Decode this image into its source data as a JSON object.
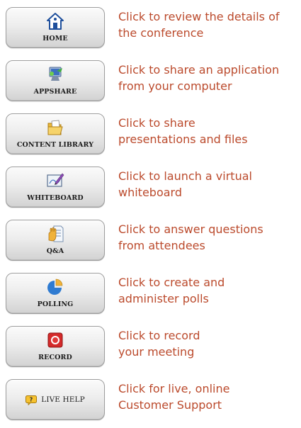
{
  "colors": {
    "description_text": "#bb4a2c",
    "button_label": "#1a1a1a"
  },
  "items": [
    {
      "button_label": "HOME",
      "icon": "home-icon",
      "desc_line1": "Click to review the details of",
      "desc_line2": "the conference"
    },
    {
      "button_label": "APPSHARE",
      "icon": "appshare-icon",
      "desc_line1": "Click to share an application",
      "desc_line2": "from your computer"
    },
    {
      "button_label": "CONTENT LIBRARY",
      "icon": "folder-icon",
      "desc_line1": "Click to share",
      "desc_line2": "presentations and files"
    },
    {
      "button_label": "WHITEBOARD",
      "icon": "whiteboard-icon",
      "desc_line1": "Click to launch a virtual",
      "desc_line2": "whiteboard"
    },
    {
      "button_label": "Q&A",
      "icon": "raised-hand-icon",
      "desc_line1": "Click to answer questions",
      "desc_line2": "from attendees"
    },
    {
      "button_label": "POLLING",
      "icon": "pie-chart-icon",
      "desc_line1": "Click to create and",
      "desc_line2": "administer polls"
    },
    {
      "button_label": "RECORD",
      "icon": "record-icon",
      "desc_line1": "Click to record",
      "desc_line2": "your meeting"
    },
    {
      "button_label": "LIVE HELP",
      "icon": "help-icon",
      "desc_line1": "Click for live, online",
      "desc_line2": "Customer Support"
    }
  ]
}
